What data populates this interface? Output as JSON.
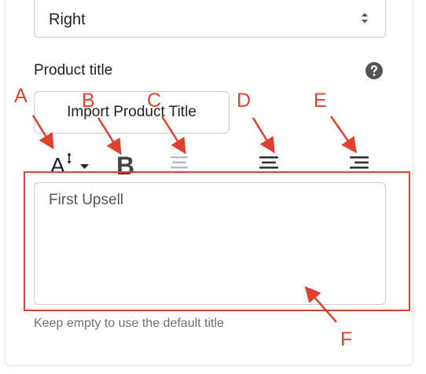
{
  "alignment_select": {
    "value": "Right"
  },
  "product_title": {
    "label": "Product title",
    "help_icon": "question-circle-icon",
    "import_button": "Import Product Title",
    "toolbar": [
      "font-size-icon",
      "bold-icon",
      "align-left-icon",
      "align-center-icon",
      "align-right-icon"
    ],
    "textarea_value": "First Upsell",
    "hint": "Keep empty to use the default title"
  },
  "annotations": {
    "color": "#e0412f",
    "labels": {
      "a": "A",
      "b": "B",
      "c": "C",
      "d": "D",
      "e": "E",
      "f": "F"
    }
  }
}
